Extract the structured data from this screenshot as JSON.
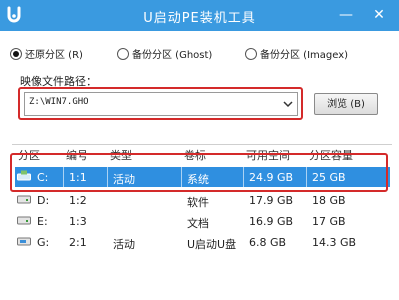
{
  "window": {
    "title": "U启动PE装机工具",
    "minimize_symbol": "—",
    "close_symbol": "✕"
  },
  "mode_options": [
    {
      "label": "还原分区 (R)",
      "selected": true
    },
    {
      "label": "备份分区 (Ghost)",
      "selected": false
    },
    {
      "label": "备份分区 (Imagex)",
      "selected": false
    }
  ],
  "image_path": {
    "label": "映像文件路径：",
    "value": "Z:\\WIN7.GHO"
  },
  "browse_button": {
    "label": "浏览 (B)"
  },
  "table": {
    "headers": [
      "分区",
      "编号",
      "类型",
      "卷标",
      "可用空间",
      "分区容量"
    ],
    "rows": [
      {
        "drive": "C:",
        "number": "1:1",
        "type": "活动",
        "label": "系统",
        "free": "24.9 GB",
        "capacity": "25 GB",
        "selected": true,
        "icon": "drive-windows-icon"
      },
      {
        "drive": "D:",
        "number": "1:2",
        "type": "",
        "label": "软件",
        "free": "17.9 GB",
        "capacity": "18 GB",
        "selected": false,
        "icon": "drive-icon"
      },
      {
        "drive": "E:",
        "number": "1:3",
        "type": "",
        "label": "文档",
        "free": "16.9 GB",
        "capacity": "17 GB",
        "selected": false,
        "icon": "drive-icon"
      },
      {
        "drive": "G:",
        "number": "2:1",
        "type": "活动",
        "label": "U启动U盘",
        "free": "6.8 GB",
        "capacity": "14.3 GB",
        "selected": false,
        "icon": "usb-drive-icon"
      }
    ]
  },
  "colors": {
    "title_bar": "#3a9ae0",
    "selection": "#2f8fe0",
    "highlight_box": "#d42a2a"
  }
}
